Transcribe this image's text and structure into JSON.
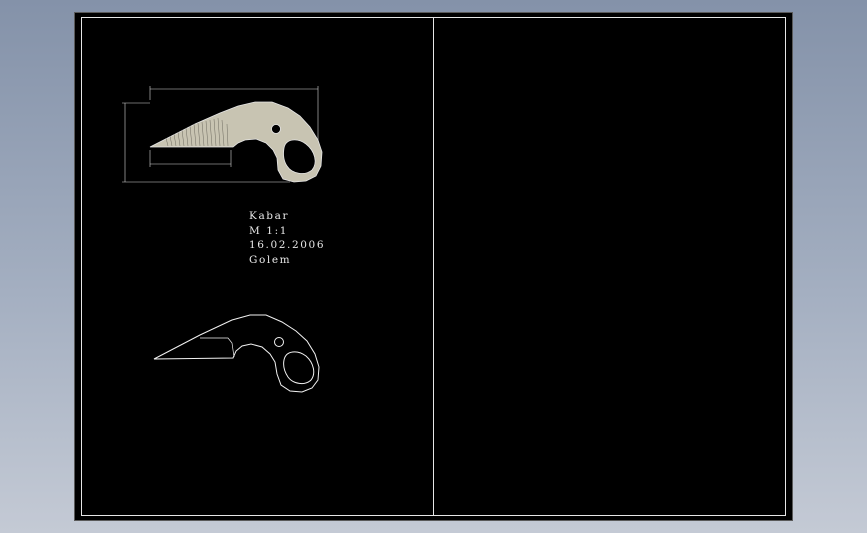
{
  "drawing": {
    "note_lines": [
      "Kabar",
      "M 1:1",
      "16.02.2006",
      "Golem"
    ]
  },
  "colors": {
    "background_top": "#8492a9",
    "background_bottom": "#c4cad5",
    "viewport": "#000000",
    "frame_lines": "#e6e6e6",
    "blade_fill": "#c8c4b2"
  },
  "icons": [
    "knife-shaded-view",
    "knife-outline-view"
  ]
}
